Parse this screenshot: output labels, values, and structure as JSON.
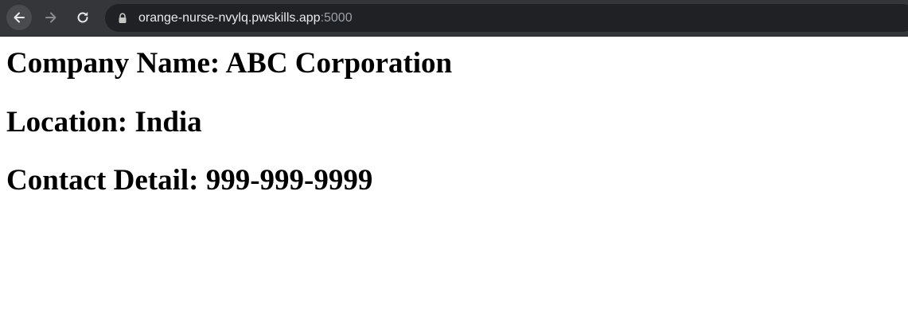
{
  "browser": {
    "url_host": "orange-nurse-nvylq.pwskills.app",
    "url_port": ":5000",
    "toolbar_bg": "#35363a",
    "omnibox_bg": "#202124",
    "icons": [
      "back-arrow-icon",
      "forward-arrow-icon",
      "reload-icon",
      "lock-icon"
    ]
  },
  "page": {
    "company": "Company Name: ABC Corporation",
    "location": "Location: India",
    "contact": "Contact Detail: 999-999-9999"
  }
}
